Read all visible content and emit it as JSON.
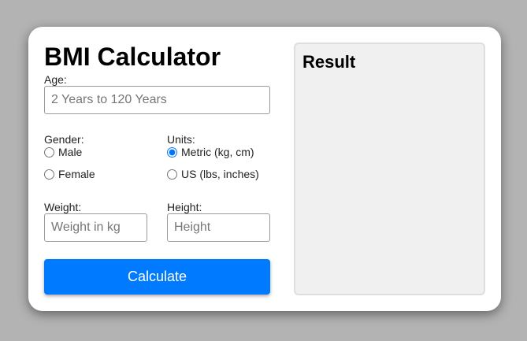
{
  "title": "BMI Calculator",
  "age": {
    "label": "Age:",
    "value": "",
    "placeholder": "2 Years to 120 Years"
  },
  "gender": {
    "label": "Gender:",
    "options": [
      "Male",
      "Female"
    ],
    "selected": null
  },
  "units": {
    "label": "Units:",
    "options": [
      "Metric (kg, cm)",
      "US (lbs, inches)"
    ],
    "selected": "Metric (kg, cm)"
  },
  "weight": {
    "label": "Weight:",
    "value": "",
    "placeholder": "Weight in kg"
  },
  "height": {
    "label": "Height:",
    "value": "",
    "placeholder": "Height"
  },
  "calculate_label": "Calculate",
  "result": {
    "title": "Result"
  },
  "colors": {
    "background": "#b3b3b3",
    "accent": "#007bff",
    "panel": "#f0f0f0"
  }
}
